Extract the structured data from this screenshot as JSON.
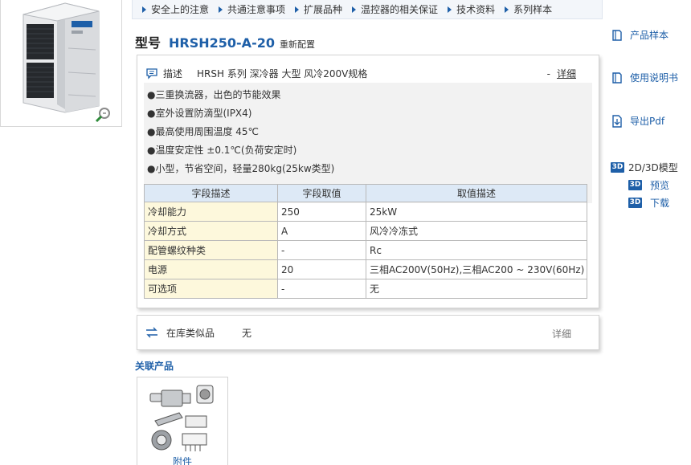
{
  "nav": {
    "items": [
      "安全上的注意",
      "共通注意事项",
      "扩展品种",
      "温控器的相关保证",
      "技术资料",
      "系列样本"
    ]
  },
  "model": {
    "label": "型号",
    "code": "HRSH250-A-20",
    "sub": "重新配置"
  },
  "description": {
    "label": "描述",
    "text": "HRSH 系列 深冷器 大型 风冷200V规格",
    "dash": "-",
    "more": "详细",
    "features": [
      "●三重换流器，出色的节能效果",
      "●室外设置防滴型(IPX4)",
      "●最高使用周围温度 45℃",
      "●温度安定性 ±0.1℃(负荷安定时)",
      "●小型，节省空间，轻量280kg(25kw类型)"
    ]
  },
  "spec_table": {
    "headers": [
      "字段描述",
      "字段取值",
      "取值描述"
    ],
    "rows": [
      [
        "冷却能力",
        "250",
        "25kW"
      ],
      [
        "冷却方式",
        "A",
        "风冷冷冻式"
      ],
      [
        "配管螺纹种类",
        "-",
        "Rc"
      ],
      [
        "电源",
        "20",
        "三相AC200V(50Hz),三相AC200 ~ 230V(60Hz)"
      ],
      [
        "可选项",
        "-",
        "无"
      ]
    ]
  },
  "similar": {
    "label": "在库类似品",
    "value": "无",
    "more": "详细"
  },
  "related": {
    "title": "关联产品",
    "item_name": "附件"
  },
  "side": {
    "catalog": "产品样本",
    "manual": "使用说明书",
    "pdf": "导出Pdf",
    "model3d": "2D/3D模型",
    "preview": "预览",
    "download": "下载",
    "badge": "3D"
  },
  "colors": {
    "accent": "#1e5fa8",
    "table_header": "#dde9f6",
    "field_cell": "#fdf8dc",
    "feature_bg": "#f2f2f2"
  }
}
